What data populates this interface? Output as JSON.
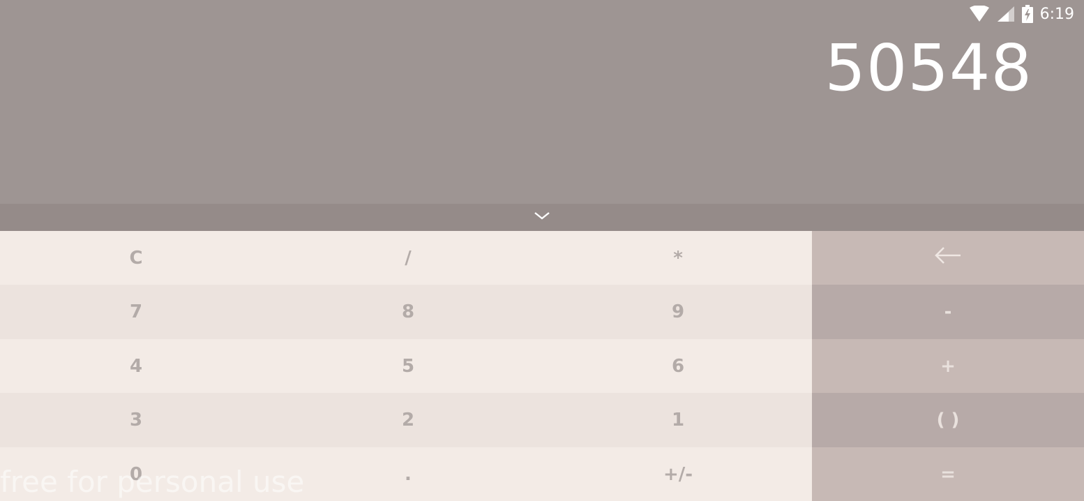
{
  "status_bar": {
    "time": "6:19",
    "icons": [
      "wifi-icon",
      "cellular-signal-icon",
      "battery-charging-icon"
    ]
  },
  "display": {
    "result": "50548"
  },
  "handle": {
    "icon": "chevron-down-icon"
  },
  "keys": {
    "clear": "C",
    "divide": "/",
    "multiply": "*",
    "backspace_icon": "backspace-arrow-icon",
    "seven": "7",
    "eight": "8",
    "nine": "9",
    "minus": "-",
    "four": "4",
    "five": "5",
    "six": "6",
    "plus": "+",
    "three": "3",
    "two": "2",
    "one": "1",
    "parentheses": "( )",
    "zero": "0",
    "decimal": ".",
    "sign": "+/-",
    "equals": "="
  },
  "watermark": "free for personal use",
  "colors": {
    "display_bg": "#9e9593",
    "handle_bg": "#958b89",
    "key_light": "#f3ebe6",
    "key_light_alt": "#ece3de",
    "operator_light": "#c7b9b5",
    "operator_dark": "#b7aaa8"
  }
}
